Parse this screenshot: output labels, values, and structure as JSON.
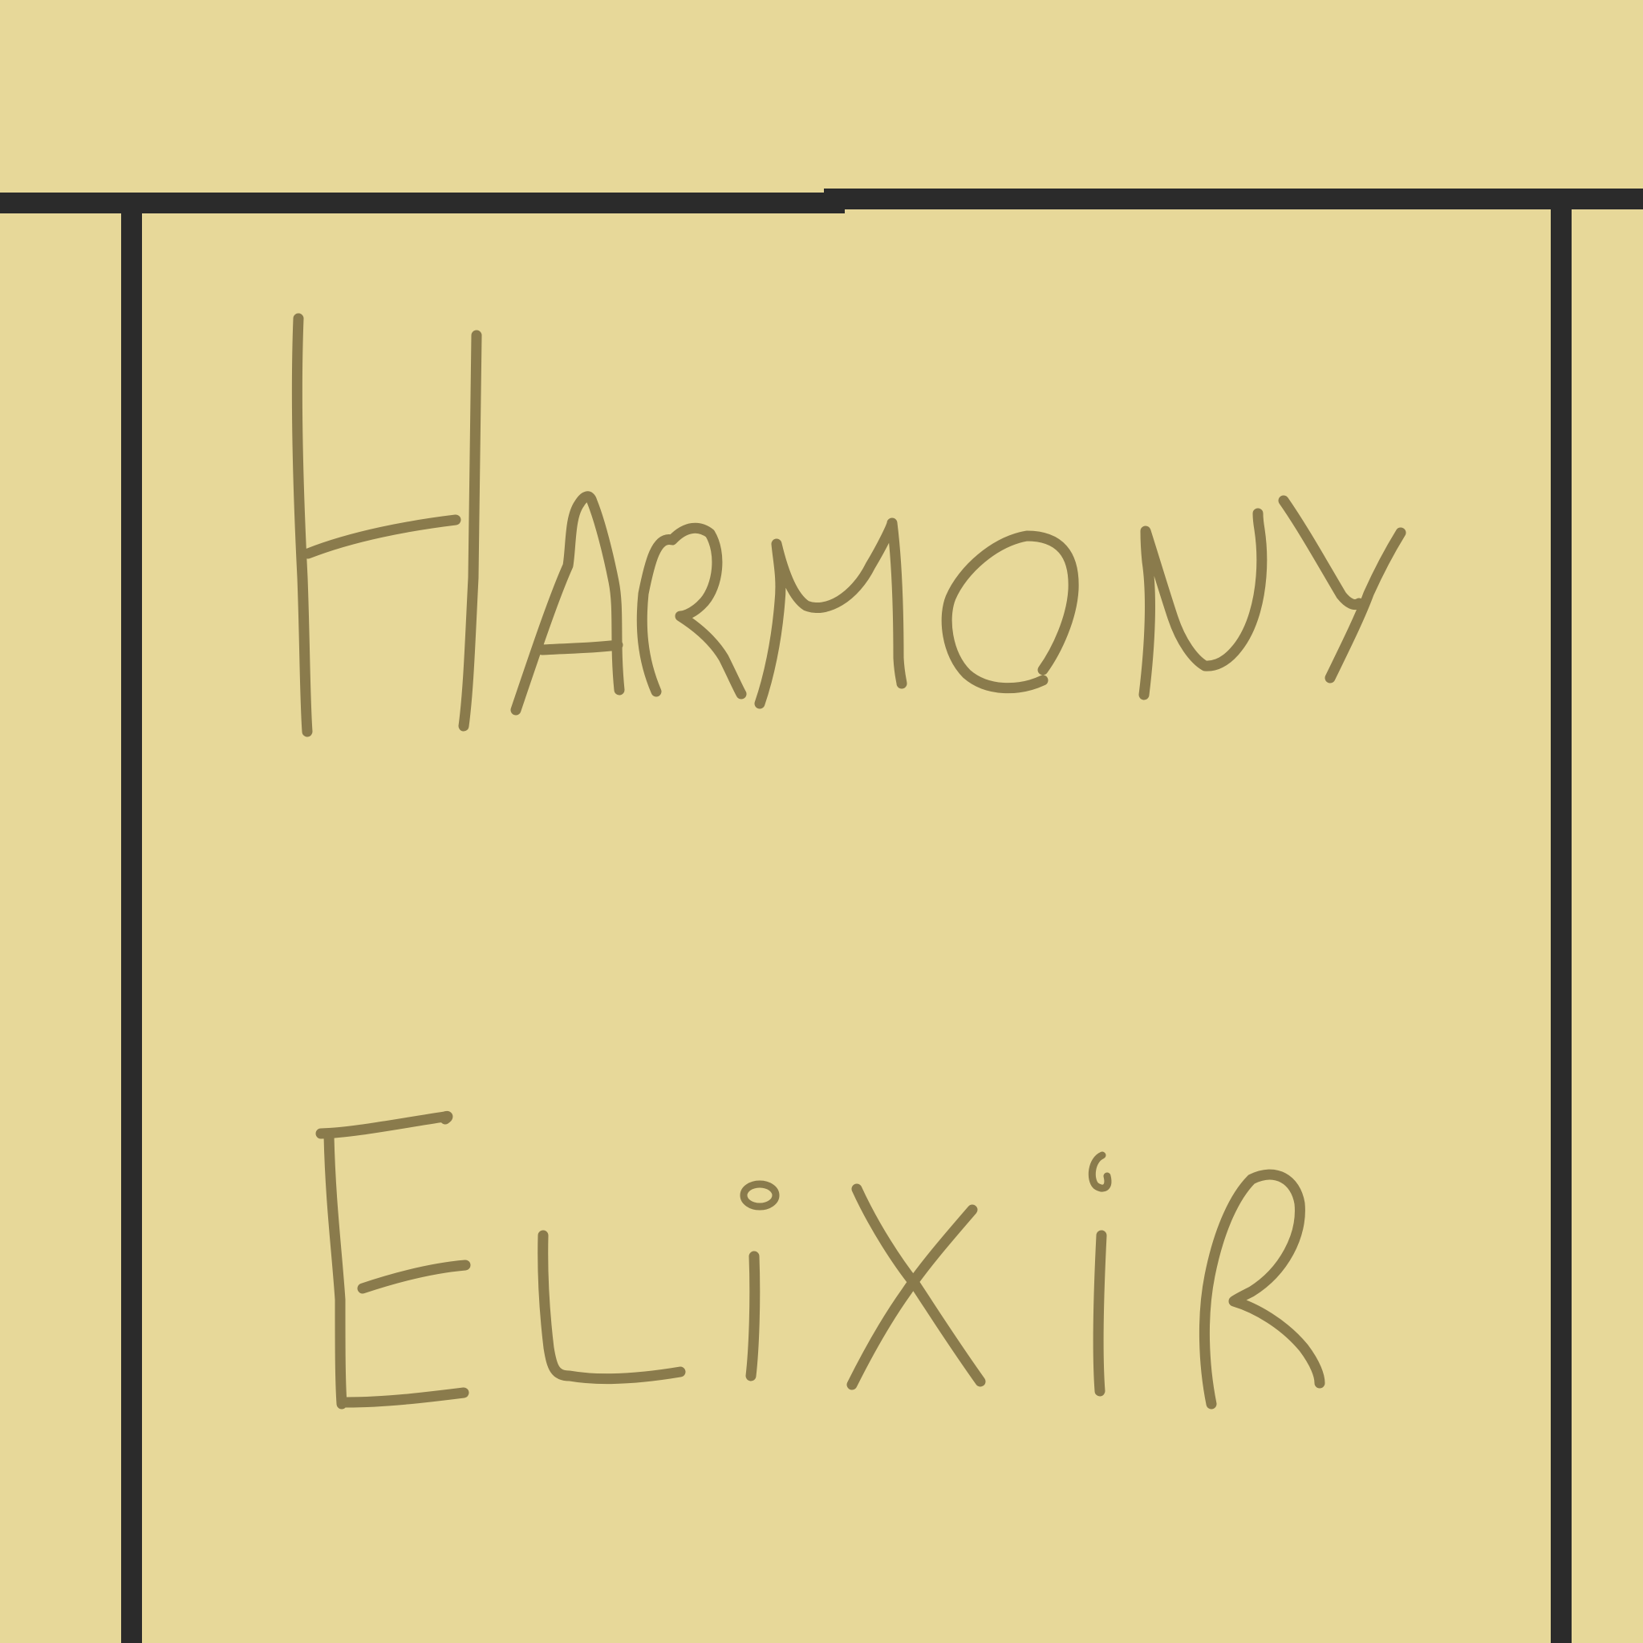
{
  "colors": {
    "background": "#e7d899",
    "frame": "#2b2b2b",
    "ink": "#8a7b4c"
  },
  "label": {
    "line1": "HARMONY",
    "line2": "ELIXIR"
  }
}
